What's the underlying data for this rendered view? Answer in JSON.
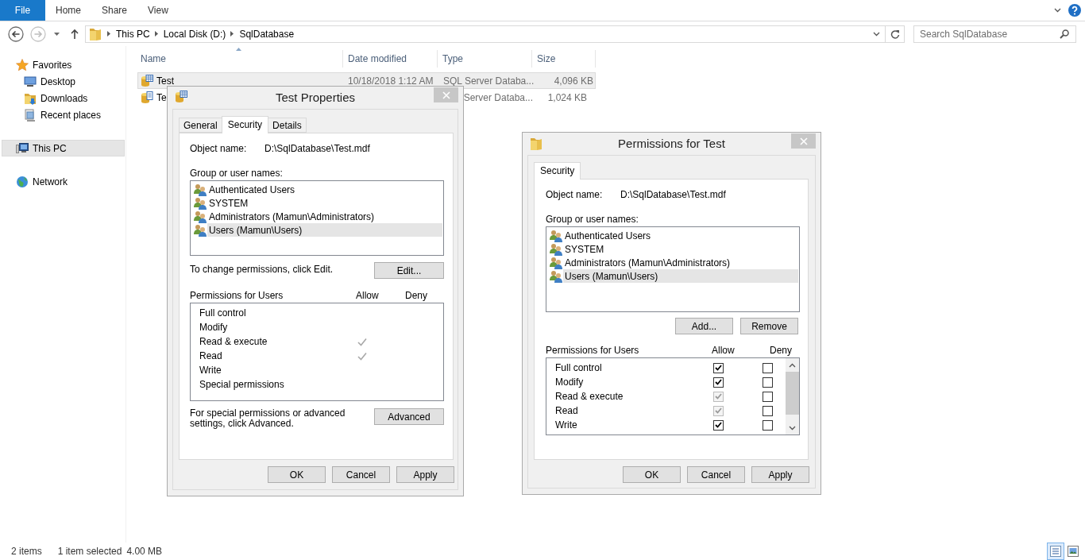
{
  "ribbon": {
    "tabs": [
      {
        "label": "File",
        "kind": "file"
      },
      {
        "label": "Home",
        "kind": "tab"
      },
      {
        "label": "Share",
        "kind": "tab"
      },
      {
        "label": "View",
        "kind": "tab"
      }
    ]
  },
  "address_bar": {
    "path": [
      "This PC",
      "Local Disk (D:)",
      "SqlDatabase"
    ]
  },
  "search": {
    "placeholder": "Search SqlDatabase"
  },
  "navigation": {
    "items": [
      {
        "label": "Favorites",
        "kind": "favorites",
        "selected": false,
        "children": [
          {
            "label": "Desktop",
            "kind": "desktop",
            "selected": false
          },
          {
            "label": "Downloads",
            "kind": "downloads",
            "selected": false
          },
          {
            "label": "Recent places",
            "kind": "recent",
            "selected": false
          }
        ]
      },
      {
        "label": "This PC",
        "kind": "pc",
        "selected": true
      },
      {
        "label": "Network",
        "kind": "network",
        "selected": false
      }
    ]
  },
  "file_list": {
    "columns": [
      "Name",
      "Date modified",
      "Type",
      "Size"
    ],
    "rows": [
      {
        "kind": "data",
        "name": "Test",
        "date_modified": "10/18/2018 1:12 AM",
        "type": "SQL Server Databa...",
        "size": "4,096 KB",
        "selected": true
      },
      {
        "kind": "log",
        "name": "Te",
        "type": "Server Databa...",
        "size": "1,024 KB",
        "selected": false
      }
    ]
  },
  "status_bar": {
    "item_count": "2 items",
    "selection": "1 item selected",
    "selection_size": "4.00 MB"
  },
  "view_buttons": [
    {
      "kind": "details",
      "selected": true
    },
    {
      "kind": "large_icons",
      "selected": false
    }
  ],
  "properties_dialog": {
    "title": "Test Properties",
    "tabs": [
      {
        "label": "General",
        "selected": false
      },
      {
        "label": "Security",
        "selected": true
      },
      {
        "label": "Details",
        "selected": false
      }
    ],
    "object_name_label": "Object name:",
    "object_name": "D:\\SqlDatabase\\Test.mdf",
    "group_label": "Group or user names:",
    "principals": [
      {
        "name": "Authenticated Users",
        "selected": false
      },
      {
        "name": "SYSTEM",
        "selected": false
      },
      {
        "name": "Administrators (Mamun\\Administrators)",
        "selected": false
      },
      {
        "name": "Users (Mamun\\Users)",
        "selected": true
      }
    ],
    "edit_hint": "To change permissions, click Edit.",
    "edit_button": "Edit...",
    "permissions_label": "Permissions for Users",
    "allow_header": "Allow",
    "deny_header": "Deny",
    "permissions": [
      {
        "label": "Full control",
        "allow": false,
        "deny": false
      },
      {
        "label": "Modify",
        "allow": false,
        "deny": false
      },
      {
        "label": "Read & execute",
        "allow": true,
        "deny": false
      },
      {
        "label": "Read",
        "allow": true,
        "deny": false
      },
      {
        "label": "Write",
        "allow": false,
        "deny": false
      },
      {
        "label": "Special permissions",
        "allow": false,
        "deny": false
      }
    ],
    "advanced_hint": "For special permissions or advanced settings, click Advanced.",
    "advanced_button": "Advanced",
    "buttons": [
      "OK",
      "Cancel",
      "Apply"
    ]
  },
  "permissions_dialog": {
    "title": "Permissions for Test",
    "tabs": [
      {
        "label": "Security",
        "selected": true
      }
    ],
    "object_name_label": "Object name:",
    "object_name": "D:\\SqlDatabase\\Test.mdf",
    "group_label": "Group or user names:",
    "principals": [
      {
        "name": "Authenticated Users",
        "selected": false
      },
      {
        "name": "SYSTEM",
        "selected": false
      },
      {
        "name": "Administrators (Mamun\\Administrators)",
        "selected": false
      },
      {
        "name": "Users (Mamun\\Users)",
        "selected": true
      }
    ],
    "principal_buttons": [
      "Add...",
      "Remove"
    ],
    "permissions_label": "Permissions for Users",
    "allow_header": "Allow",
    "deny_header": "Deny",
    "permissions": [
      {
        "label": "Full control",
        "allow": true,
        "allow_disabled": false,
        "deny": false
      },
      {
        "label": "Modify",
        "allow": true,
        "allow_disabled": false,
        "deny": false
      },
      {
        "label": "Read & execute",
        "allow": true,
        "allow_disabled": true,
        "deny": false
      },
      {
        "label": "Read",
        "allow": true,
        "allow_disabled": true,
        "deny": false
      },
      {
        "label": "Write",
        "allow": true,
        "allow_disabled": false,
        "deny": false
      }
    ],
    "buttons": [
      "OK",
      "Cancel",
      "Apply"
    ]
  }
}
